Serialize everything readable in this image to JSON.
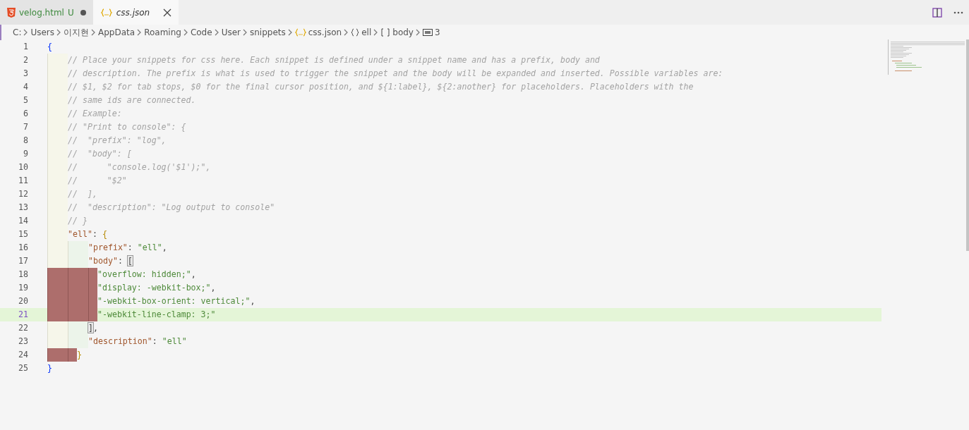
{
  "tabs": [
    {
      "label": "velog.html",
      "kind": "html",
      "badge": "U",
      "modified": true,
      "selected": false,
      "italic": false
    },
    {
      "label": "css.json",
      "kind": "json",
      "modified": false,
      "selected": true,
      "italic": true
    }
  ],
  "actions": [
    {
      "kind": "split"
    },
    {
      "kind": "more"
    }
  ],
  "breadcrumbs": [
    {
      "label": "C:",
      "kind": "folder"
    },
    {
      "label": "Users",
      "kind": "folder"
    },
    {
      "label": "이지현",
      "kind": "folder"
    },
    {
      "label": "AppData",
      "kind": "folder"
    },
    {
      "label": "Roaming",
      "kind": "folder"
    },
    {
      "label": "Code",
      "kind": "folder"
    },
    {
      "label": "User",
      "kind": "folder"
    },
    {
      "label": "snippets",
      "kind": "folder"
    },
    {
      "label": "css.json",
      "kind": "json"
    },
    {
      "label": "ell",
      "kind": "object"
    },
    {
      "label": "body",
      "kind": "array"
    },
    {
      "label": "3",
      "kind": "string"
    }
  ],
  "lines": [
    {
      "number": "1",
      "current": false,
      "error": false,
      "tokens": [
        {
          "kind": "brace-outer",
          "text": "{"
        }
      ]
    },
    {
      "number": "2",
      "current": false,
      "error": false,
      "indent": [
        {
          "kind": "tab"
        }
      ],
      "tokens": [
        {
          "kind": "comment",
          "text": "// Place your snippets for css here. Each snippet is defined under a snippet name and has a prefix, body and"
        }
      ]
    },
    {
      "number": "3",
      "current": false,
      "error": false,
      "indent": [
        {
          "kind": "tab"
        }
      ],
      "tokens": [
        {
          "kind": "comment",
          "text": "// description. The prefix is what is used to trigger the snippet and the body will be expanded and inserted. Possible variables are:"
        }
      ]
    },
    {
      "number": "4",
      "current": false,
      "error": false,
      "indent": [
        {
          "kind": "tab"
        }
      ],
      "tokens": [
        {
          "kind": "comment",
          "text": "// $1, $2 for tab stops, $0 for the final cursor position, and ${1:label}, ${2:another} for placeholders. Placeholders with the"
        }
      ]
    },
    {
      "number": "5",
      "current": false,
      "error": false,
      "indent": [
        {
          "kind": "tab"
        }
      ],
      "tokens": [
        {
          "kind": "comment",
          "text": "// same ids are connected."
        }
      ]
    },
    {
      "number": "6",
      "current": false,
      "error": false,
      "indent": [
        {
          "kind": "tab"
        }
      ],
      "tokens": [
        {
          "kind": "comment",
          "text": "// Example:"
        }
      ]
    },
    {
      "number": "7",
      "current": false,
      "error": false,
      "indent": [
        {
          "kind": "tab"
        }
      ],
      "tokens": [
        {
          "kind": "comment",
          "text": "// \"Print to console\": {"
        }
      ]
    },
    {
      "number": "8",
      "current": false,
      "error": false,
      "indent": [
        {
          "kind": "tab"
        }
      ],
      "tokens": [
        {
          "kind": "comment",
          "text": "//  \"prefix\": \"log\","
        }
      ]
    },
    {
      "number": "9",
      "current": false,
      "error": false,
      "indent": [
        {
          "kind": "tab"
        }
      ],
      "tokens": [
        {
          "kind": "comment",
          "text": "//  \"body\": ["
        }
      ]
    },
    {
      "number": "10",
      "current": false,
      "error": false,
      "indent": [
        {
          "kind": "tab"
        }
      ],
      "tokens": [
        {
          "kind": "comment",
          "text": "//      \"console.log('$1');\","
        }
      ]
    },
    {
      "number": "11",
      "current": false,
      "error": false,
      "indent": [
        {
          "kind": "tab"
        }
      ],
      "tokens": [
        {
          "kind": "comment",
          "text": "//      \"$2\""
        }
      ]
    },
    {
      "number": "12",
      "current": false,
      "error": false,
      "indent": [
        {
          "kind": "tab"
        }
      ],
      "tokens": [
        {
          "kind": "comment",
          "text": "//  ],"
        }
      ]
    },
    {
      "number": "13",
      "current": false,
      "error": false,
      "indent": [
        {
          "kind": "tab"
        }
      ],
      "tokens": [
        {
          "kind": "comment",
          "text": "//  \"description\": \"Log output to console\""
        }
      ]
    },
    {
      "number": "14",
      "current": false,
      "error": false,
      "indent": [
        {
          "kind": "tab"
        }
      ],
      "tokens": [
        {
          "kind": "comment",
          "text": "// }"
        }
      ]
    },
    {
      "number": "15",
      "current": false,
      "error": false,
      "indent": [
        {
          "kind": "tab"
        }
      ],
      "tokens": [
        {
          "kind": "key",
          "text": "\"ell\""
        },
        {
          "kind": "punct",
          "text": ": "
        },
        {
          "kind": "brace",
          "text": "{"
        }
      ]
    },
    {
      "number": "16",
      "current": false,
      "error": false,
      "indent": [
        {
          "kind": "tab"
        },
        {
          "kind": "tab"
        }
      ],
      "tokens": [
        {
          "kind": "key",
          "text": "\"prefix\""
        },
        {
          "kind": "punct",
          "text": ": "
        },
        {
          "kind": "string",
          "text": "\"ell\""
        },
        {
          "kind": "punct",
          "text": ","
        }
      ]
    },
    {
      "number": "17",
      "current": false,
      "error": false,
      "indent": [
        {
          "kind": "tab"
        },
        {
          "kind": "tab"
        }
      ],
      "tokens": [
        {
          "kind": "key",
          "text": "\"body\""
        },
        {
          "kind": "punct",
          "text": ": "
        },
        {
          "kind": "match",
          "text": "["
        }
      ]
    },
    {
      "number": "18",
      "current": false,
      "error": true,
      "indent": [
        {
          "kind": "tab"
        },
        {
          "kind": "tab"
        },
        {
          "kind": "half"
        }
      ],
      "tokens": [
        {
          "kind": "string",
          "text": "\"overflow: hidden;\""
        },
        {
          "kind": "punct",
          "text": ","
        }
      ]
    },
    {
      "number": "19",
      "current": false,
      "error": true,
      "indent": [
        {
          "kind": "tab"
        },
        {
          "kind": "tab"
        },
        {
          "kind": "half"
        }
      ],
      "tokens": [
        {
          "kind": "string",
          "text": "\"display: -webkit-box;\""
        },
        {
          "kind": "punct",
          "text": ","
        }
      ]
    },
    {
      "number": "20",
      "current": false,
      "error": true,
      "indent": [
        {
          "kind": "tab"
        },
        {
          "kind": "tab"
        },
        {
          "kind": "half"
        }
      ],
      "tokens": [
        {
          "kind": "string",
          "text": "\"-webkit-box-orient: vertical;\""
        },
        {
          "kind": "punct",
          "text": ","
        }
      ]
    },
    {
      "number": "21",
      "current": true,
      "error": true,
      "indent": [
        {
          "kind": "tab"
        },
        {
          "kind": "tab"
        },
        {
          "kind": "half"
        }
      ],
      "tokens": [
        {
          "kind": "string",
          "text": "\"-webkit-line-clamp: 3;\""
        }
      ]
    },
    {
      "number": "22",
      "current": false,
      "error": false,
      "indent": [
        {
          "kind": "tab"
        },
        {
          "kind": "tab"
        }
      ],
      "tokens": [
        {
          "kind": "match",
          "text": "]"
        },
        {
          "kind": "punct",
          "text": ","
        }
      ]
    },
    {
      "number": "23",
      "current": false,
      "error": false,
      "indent": [
        {
          "kind": "tab"
        },
        {
          "kind": "tab"
        }
      ],
      "tokens": [
        {
          "kind": "key",
          "text": "\"description\""
        },
        {
          "kind": "punct",
          "text": ": "
        },
        {
          "kind": "string",
          "text": "\"ell\""
        }
      ]
    },
    {
      "number": "24",
      "current": false,
      "error": true,
      "indent": [
        {
          "kind": "tab"
        },
        {
          "kind": "half"
        }
      ],
      "tokens": [
        {
          "kind": "brace",
          "text": "}"
        }
      ]
    },
    {
      "number": "25",
      "current": false,
      "error": false,
      "tokens": [
        {
          "kind": "brace-outer",
          "text": "}"
        }
      ]
    }
  ]
}
